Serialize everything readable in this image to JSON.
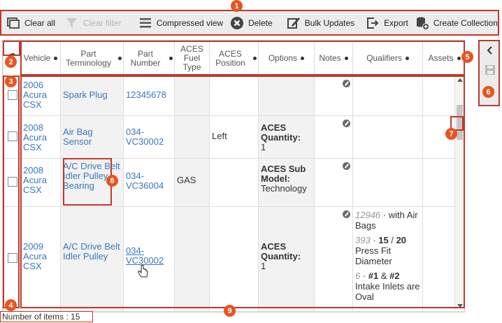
{
  "toolbar": {
    "clear_all": "Clear all",
    "clear_filter": "Clear filter",
    "compressed_view": "Compressed view",
    "delete": "Delete",
    "bulk_updates": "Bulk Updates",
    "export": "Export",
    "create_collection": "Create Collection"
  },
  "columns": {
    "vehicle": "Vehicle",
    "part_terminology": "Part Terminology",
    "part_number": "Part Number",
    "aces_fuel_type": "ACES Fuel Type",
    "aces_position": "ACES Position",
    "options": "Options",
    "notes": "Notes",
    "qualifiers": "Qualifiers",
    "assets": "Assets"
  },
  "rows": [
    {
      "vehicle": "2006 Acura CSX",
      "part_terminology": "Spark Plug",
      "part_number": "12345678",
      "fuel": "",
      "position": "",
      "option_label": "",
      "option_value": ""
    },
    {
      "vehicle": "2008 Acura CSX",
      "part_terminology": "Air Bag Sensor",
      "part_number": "034-VC30002",
      "fuel": "",
      "position": "Left",
      "option_label": "ACES Quantity:",
      "option_value": "1"
    },
    {
      "vehicle": "2008 Acura CSX",
      "part_terminology": "A/C Drive Belt Idler Pulley Bearing",
      "part_number": "034-VC36004",
      "fuel": "GAS",
      "position": "",
      "option_label": "ACES Sub Model:",
      "option_value": "Technology"
    },
    {
      "vehicle": "2009 Acura CSX",
      "part_terminology": "A/C Drive Belt Idler Pulley",
      "part_number": "034-VC30002",
      "fuel": "",
      "position": "",
      "option_label": "ACES Quantity:",
      "option_value": "1"
    }
  ],
  "qualifiers_row4": [
    {
      "code": "12946",
      "text_pre": " · with Air Bags",
      "bold": "",
      "text_mid": "",
      "bold2": "",
      "text_post": ""
    },
    {
      "code": "393",
      "text_pre": " · ",
      "bold": "15",
      "text_mid": " / ",
      "bold2": "20",
      "text_post": " Press Fit Diameter"
    },
    {
      "code": "6",
      "text_pre": " · ",
      "bold": "#1",
      "text_mid": " & ",
      "bold2": "#2",
      "text_post": " Intake Inlets are Oval"
    }
  ],
  "footer": {
    "count_text": "Number of items : 15"
  },
  "badges": [
    "1",
    "2",
    "3",
    "4",
    "5",
    "6",
    "7",
    "8",
    "9"
  ],
  "colors": {
    "highlight": "#c0392b",
    "badge": "#e8541f",
    "link": "#3b77b7",
    "toolbar_bg": "#ececec"
  }
}
